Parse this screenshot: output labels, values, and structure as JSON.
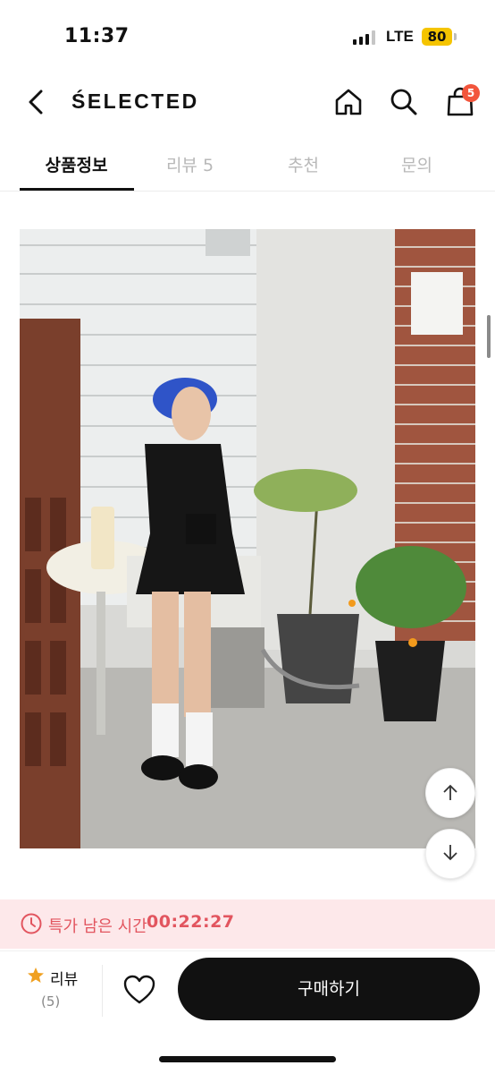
{
  "status_bar": {
    "time": "11:37",
    "network": "LTE",
    "battery": "80"
  },
  "header": {
    "brand": "ŚELECTED",
    "cart_count": "5",
    "icons": [
      "back-arrow-icon",
      "home-icon",
      "search-icon",
      "shopping-bag-icon"
    ]
  },
  "tabs": [
    {
      "label": "상품정보",
      "active": true
    },
    {
      "label": "리뷰 5",
      "active": false
    },
    {
      "label": "추천",
      "active": false
    },
    {
      "label": "문의",
      "active": false
    }
  ],
  "product_image": {
    "alt": "product photo"
  },
  "scroll_buttons": {
    "up": "arrow-up-icon",
    "down": "arrow-down-icon"
  },
  "timer": {
    "label": "특가 남은 시간",
    "value": "00:22:27",
    "color": "#e2555f",
    "background": "#fde8ea"
  },
  "bottom_bar": {
    "review_label": "리뷰",
    "review_count": "(5)",
    "buy_label": "구매하기",
    "star_color": "#f0a020"
  }
}
